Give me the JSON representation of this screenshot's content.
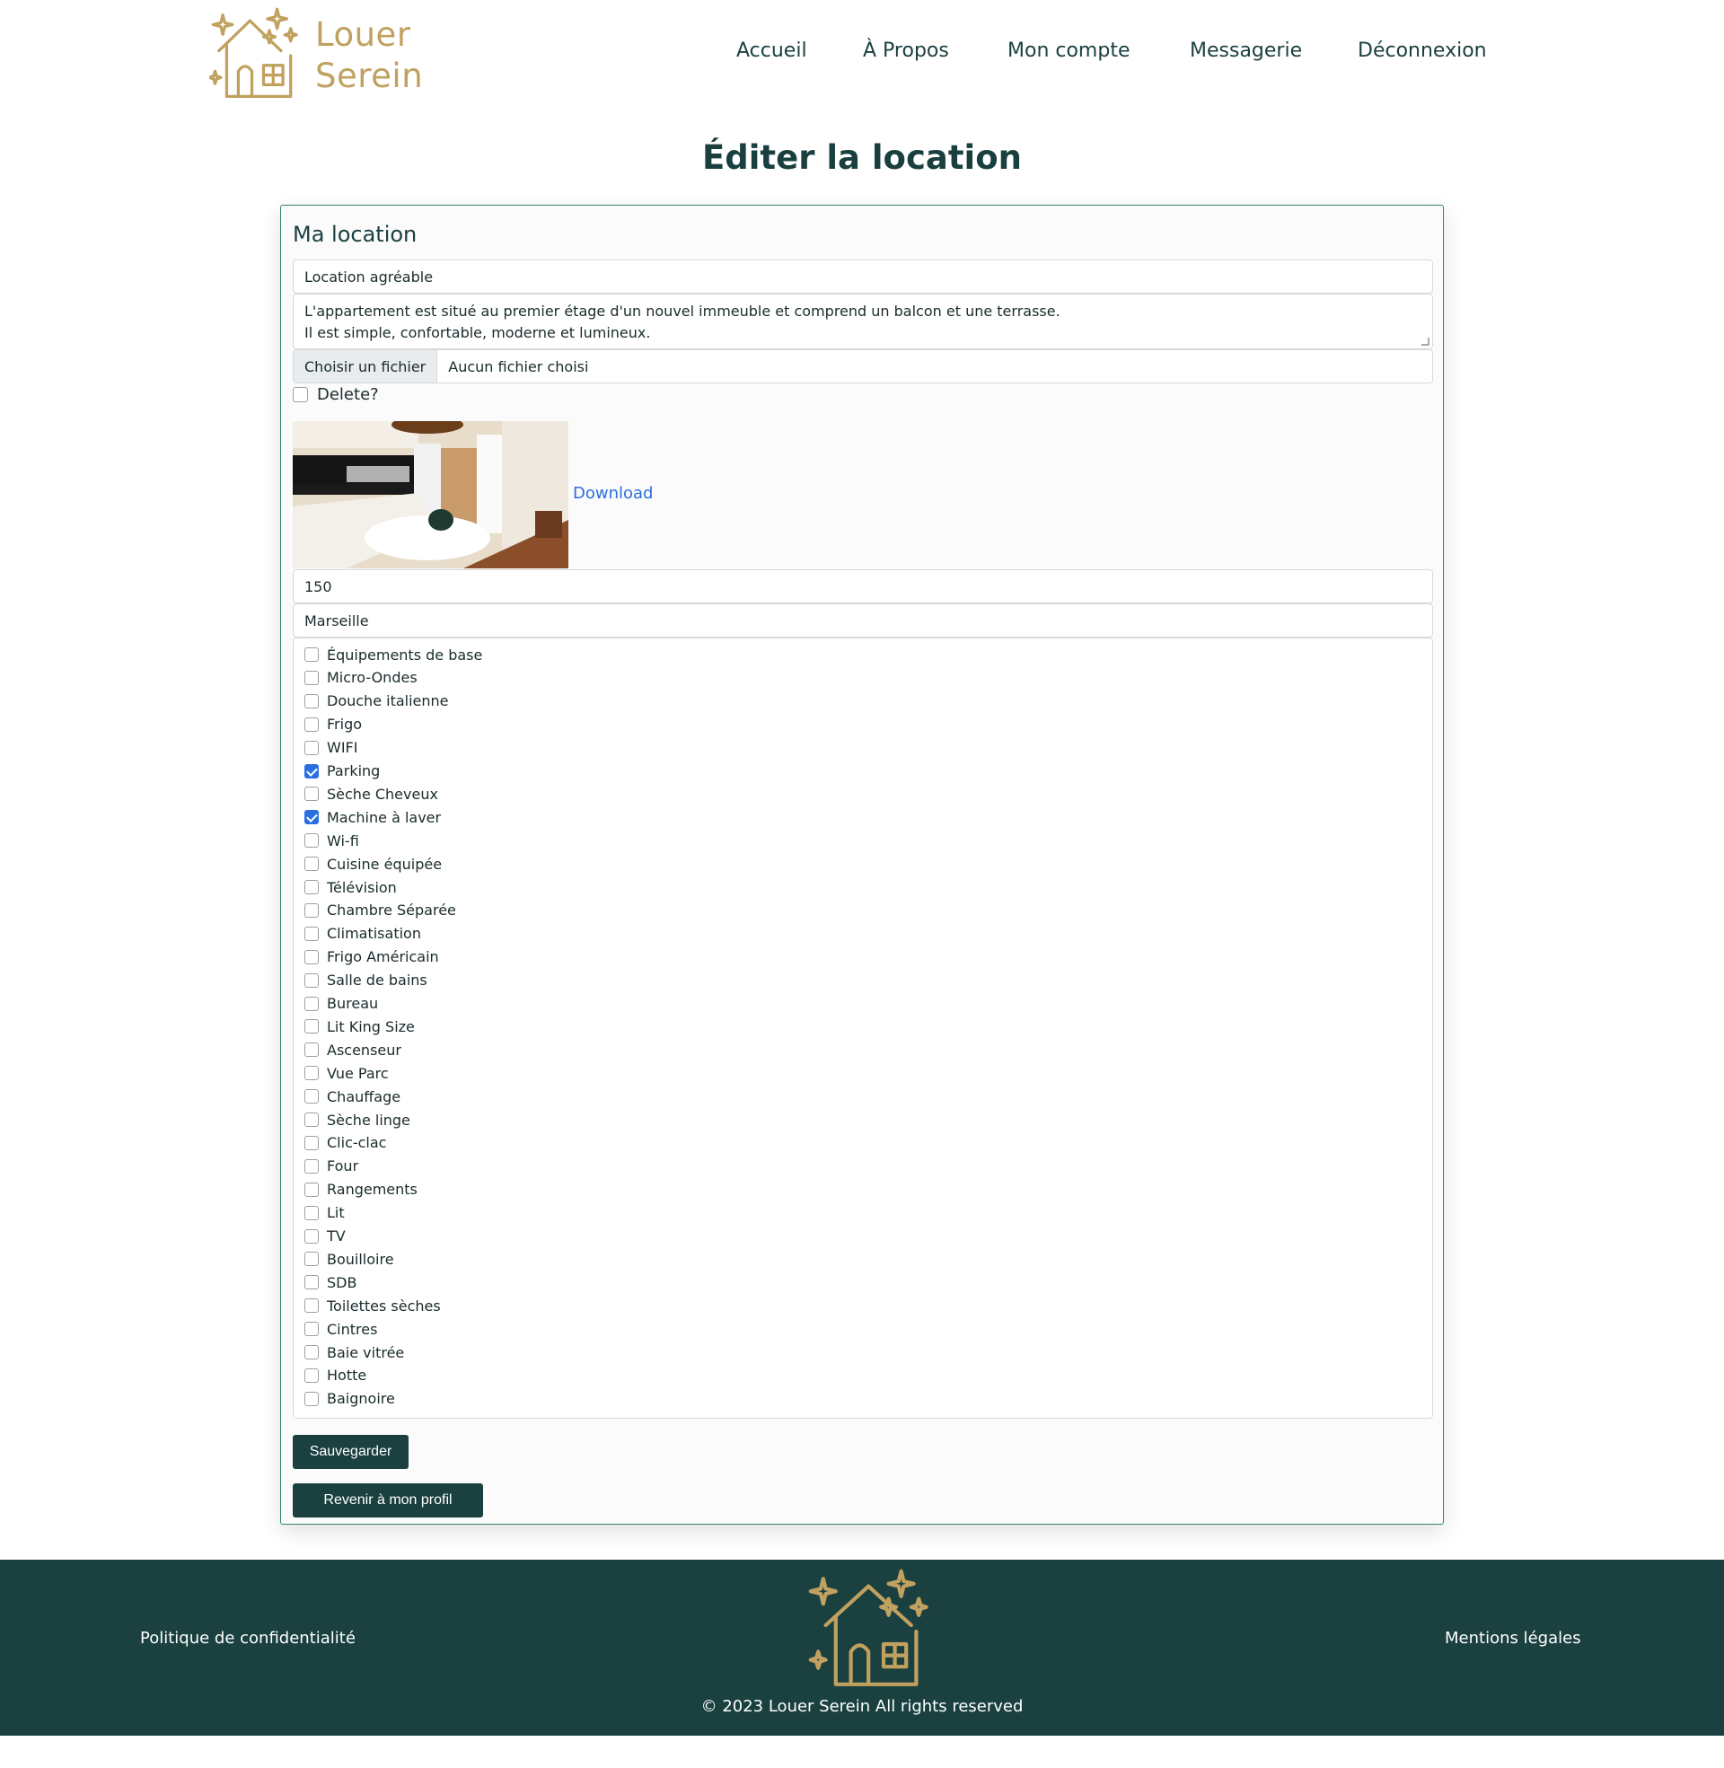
{
  "brand": {
    "name_line1": "Louer",
    "name_line2": "Serein",
    "color": "#c0a15f"
  },
  "nav": {
    "items": [
      "Accueil",
      "À Propos",
      "Mon compte",
      "Messagerie",
      "Déconnexion"
    ]
  },
  "page": {
    "title": "Éditer la location"
  },
  "form": {
    "card_title": "Ma location",
    "title_value": "Location agréable",
    "description_line1": "L'appartement est situé au premier étage d'un nouvel immeuble et comprend un balcon et une terrasse.",
    "description_line2": "Il est simple, confortable, moderne et lumineux.",
    "file_button": "Choisir un fichier",
    "file_status": "Aucun fichier choisi",
    "delete_label": "Delete?",
    "delete_checked": false,
    "download_label": "Download",
    "price_value": "150",
    "city_value": "Marseille",
    "amenities": [
      {
        "label": "Équipements de base",
        "checked": false
      },
      {
        "label": "Micro-Ondes",
        "checked": false
      },
      {
        "label": "Douche italienne",
        "checked": false
      },
      {
        "label": "Frigo",
        "checked": false
      },
      {
        "label": "WIFI",
        "checked": false
      },
      {
        "label": "Parking",
        "checked": true
      },
      {
        "label": "Sèche Cheveux",
        "checked": false
      },
      {
        "label": "Machine à laver",
        "checked": true
      },
      {
        "label": "Wi-fi",
        "checked": false
      },
      {
        "label": "Cuisine équipée",
        "checked": false
      },
      {
        "label": "Télévision",
        "checked": false
      },
      {
        "label": "Chambre Séparée",
        "checked": false
      },
      {
        "label": "Climatisation",
        "checked": false
      },
      {
        "label": "Frigo Américain",
        "checked": false
      },
      {
        "label": "Salle de bains",
        "checked": false
      },
      {
        "label": "Bureau",
        "checked": false
      },
      {
        "label": "Lit King Size",
        "checked": false
      },
      {
        "label": "Ascenseur",
        "checked": false
      },
      {
        "label": "Vue Parc",
        "checked": false
      },
      {
        "label": "Chauffage",
        "checked": false
      },
      {
        "label": "Sèche linge",
        "checked": false
      },
      {
        "label": "Clic-clac",
        "checked": false
      },
      {
        "label": "Four",
        "checked": false
      },
      {
        "label": "Rangements",
        "checked": false
      },
      {
        "label": "Lit",
        "checked": false
      },
      {
        "label": "TV",
        "checked": false
      },
      {
        "label": "Bouilloire",
        "checked": false
      },
      {
        "label": "SDB",
        "checked": false
      },
      {
        "label": "Toilettes sèches",
        "checked": false
      },
      {
        "label": "Cintres",
        "checked": false
      },
      {
        "label": "Baie vitrée",
        "checked": false
      },
      {
        "label": "Hotte",
        "checked": false
      },
      {
        "label": "Baignoire",
        "checked": false
      }
    ],
    "save_button": "Sauvegarder",
    "back_button": "Revenir à mon profil"
  },
  "footer": {
    "privacy": "Politique de confidentialité",
    "legal": "Mentions légales",
    "copyright": "© 2023 Louer Serein All rights reserved",
    "background": "#1a4040"
  },
  "icons": {
    "logo": "house-sparkles-icon",
    "checkbox_checked": "check-icon"
  }
}
